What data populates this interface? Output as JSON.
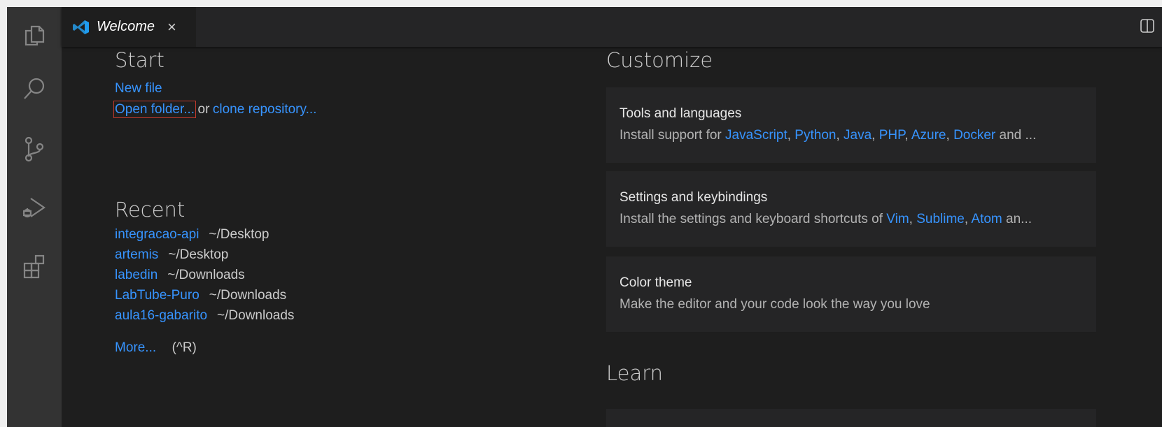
{
  "tab": {
    "title": "Welcome",
    "close_glyph": "×"
  },
  "start": {
    "heading": "Start",
    "new_file": "New file",
    "open_folder": "Open folder...",
    "or_text": "or",
    "clone_repo": "clone repository..."
  },
  "recent": {
    "heading": "Recent",
    "items": [
      {
        "name": "integracao-api",
        "path": "~/Desktop"
      },
      {
        "name": "artemis",
        "path": "~/Desktop"
      },
      {
        "name": "labedin",
        "path": "~/Downloads"
      },
      {
        "name": "LabTube-Puro",
        "path": "~/Downloads"
      },
      {
        "name": "aula16-gabarito",
        "path": "~/Downloads"
      }
    ],
    "more_label": "More...",
    "more_shortcut": "(^R)"
  },
  "customize": {
    "heading": "Customize",
    "cards": [
      {
        "title": "Tools and languages",
        "desc_prefix": "Install support for ",
        "links": [
          "JavaScript",
          "Python",
          "Java",
          "PHP",
          "Azure",
          "Docker"
        ],
        "desc_suffix": " and ..."
      },
      {
        "title": "Settings and keybindings",
        "desc_prefix": "Install the settings and keyboard shortcuts of ",
        "links": [
          "Vim",
          "Sublime",
          "Atom"
        ],
        "desc_suffix": " an..."
      },
      {
        "title": "Color theme",
        "desc": "Make the editor and your code look the way you love"
      }
    ]
  },
  "learn": {
    "heading": "Learn"
  },
  "activity_bar": {
    "icons": [
      "explorer-icon",
      "search-icon",
      "source-control-icon",
      "run-debug-icon",
      "extensions-icon"
    ]
  },
  "colors": {
    "link": "#3794ff",
    "editor_bg": "#1e1e1e",
    "activity_bg": "#333333",
    "card_bg": "#252526",
    "highlight_box": "#c0392b"
  }
}
